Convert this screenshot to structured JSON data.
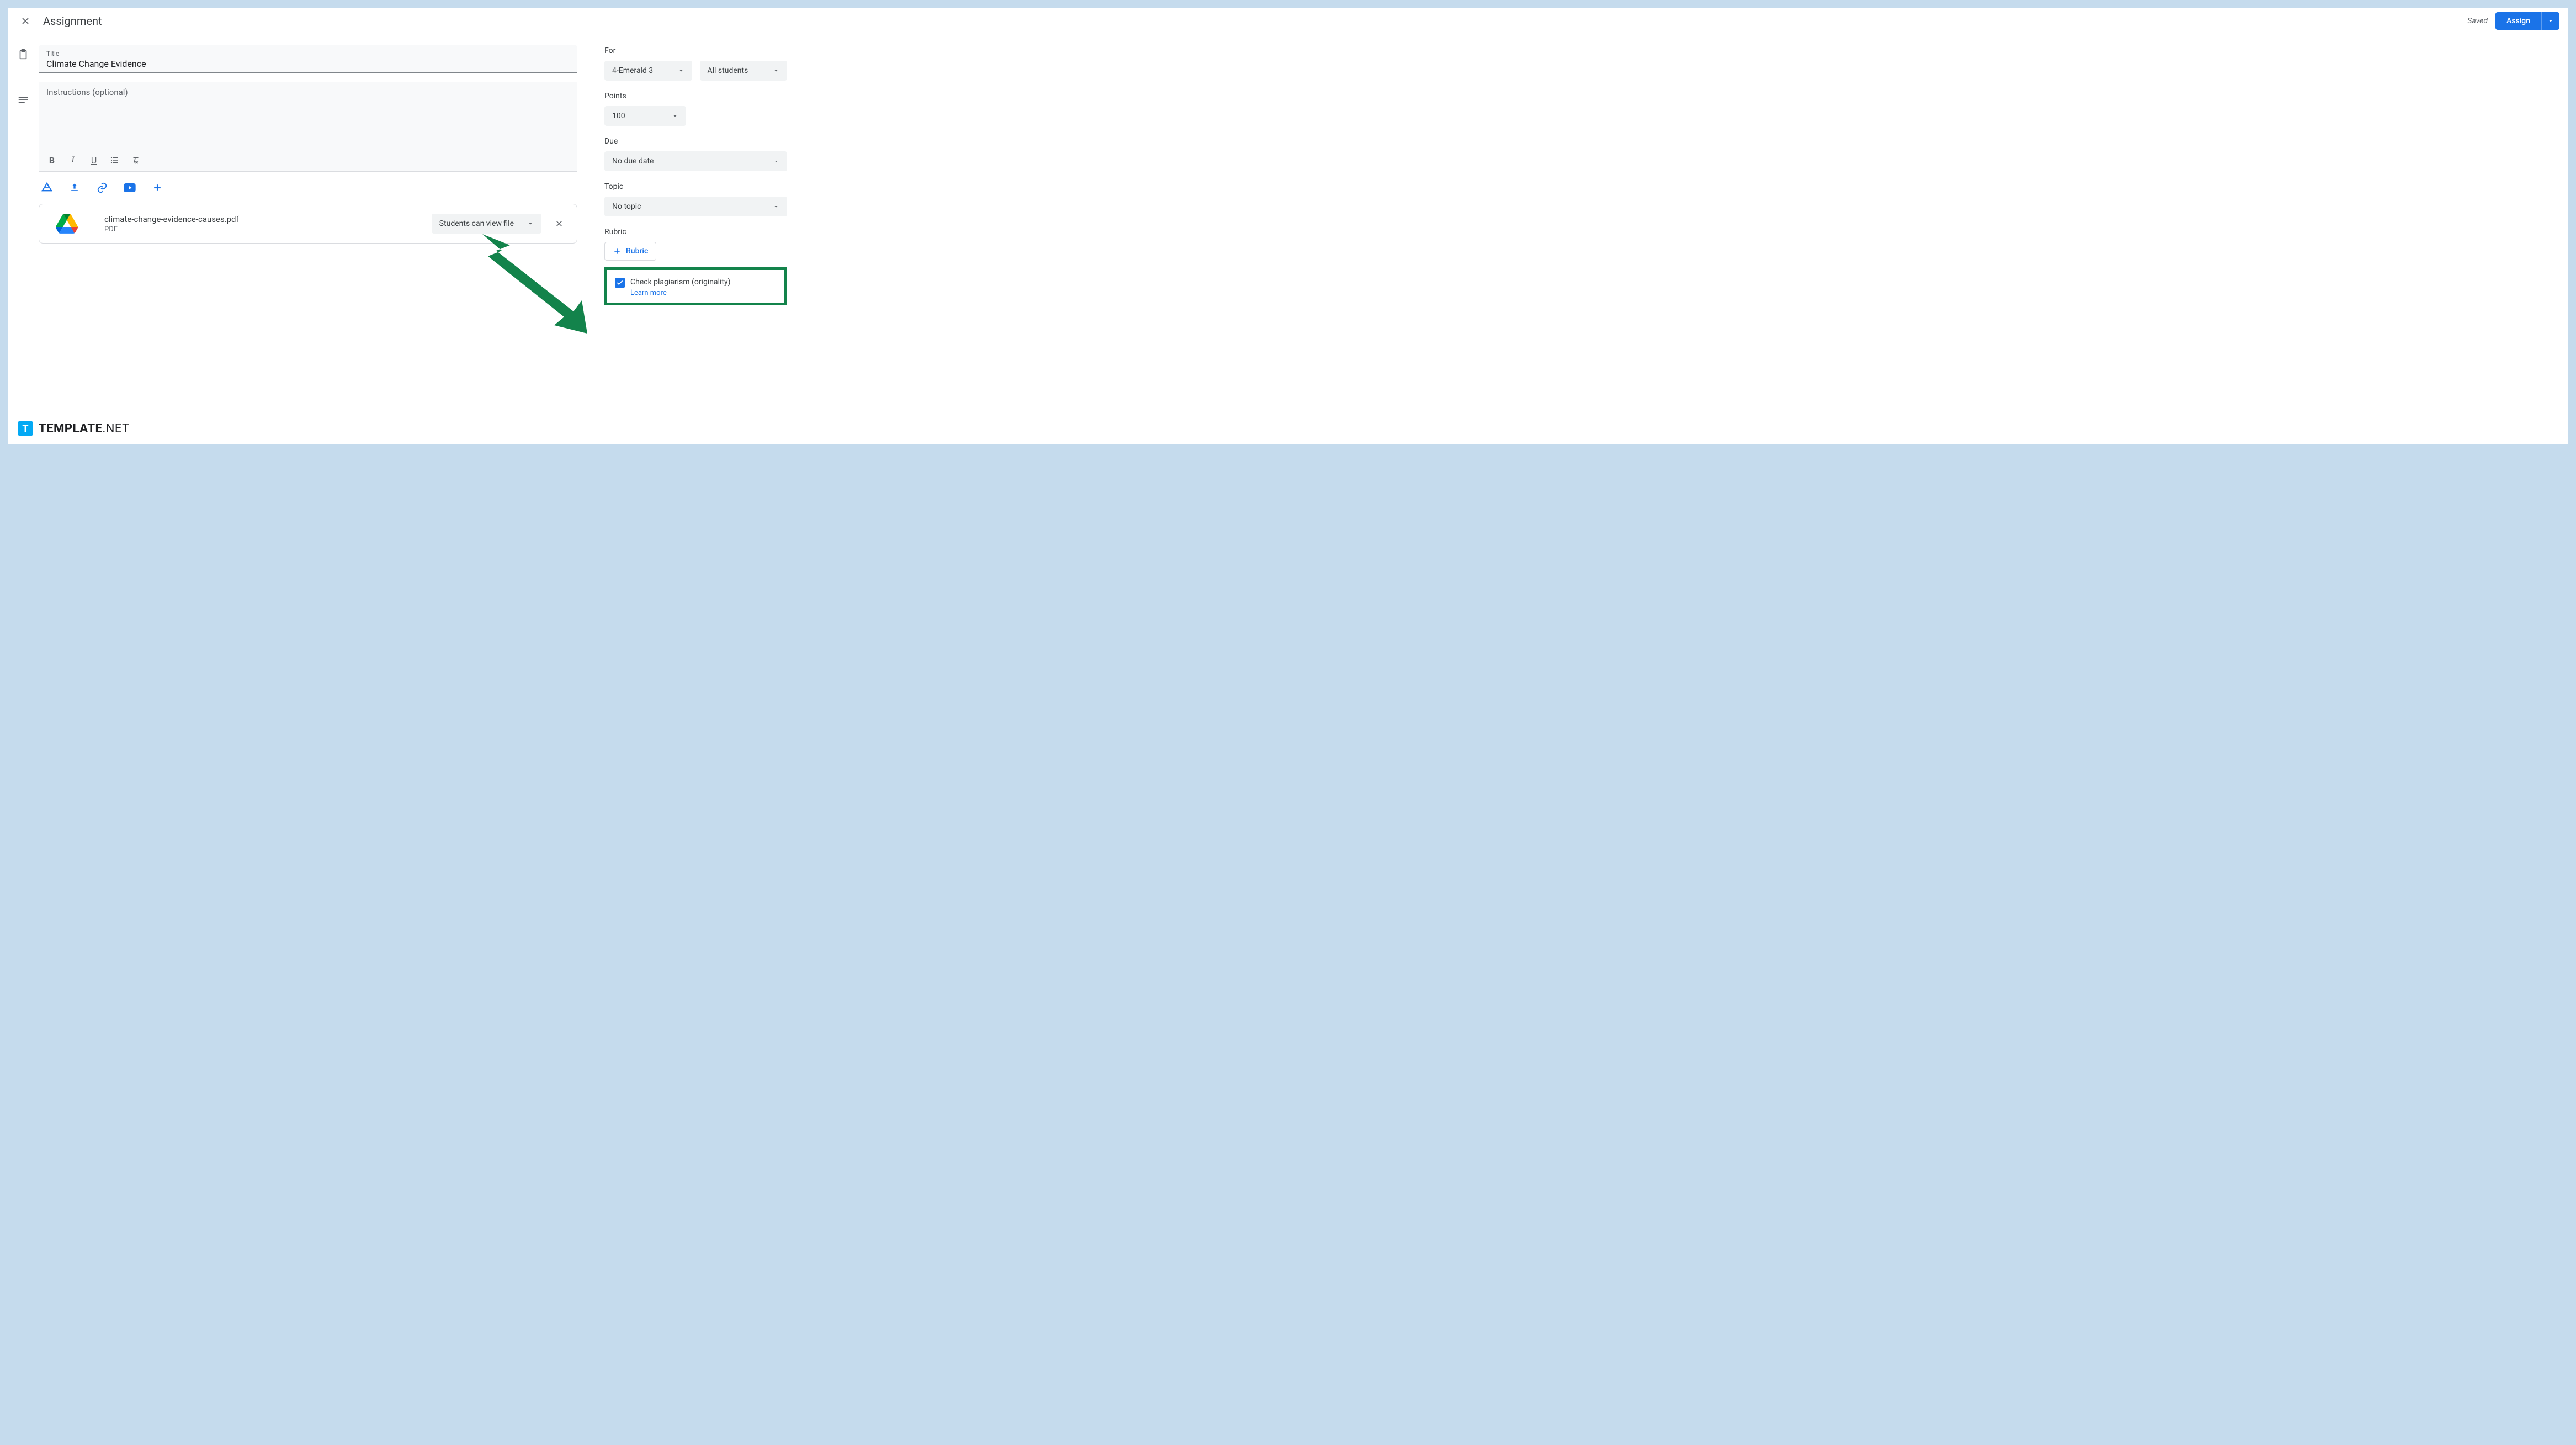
{
  "header": {
    "title": "Assignment",
    "saved": "Saved",
    "assign": "Assign"
  },
  "main": {
    "title_label": "Title",
    "title_value": "Climate Change Evidence",
    "instructions_placeholder": "Instructions (optional)",
    "attachment": {
      "name": "climate-change-evidence-causes.pdf",
      "type": "PDF",
      "permission": "Students can view file"
    }
  },
  "sidebar": {
    "for_label": "For",
    "class_value": "4-Emerald 3",
    "students_value": "All students",
    "points_label": "Points",
    "points_value": "100",
    "due_label": "Due",
    "due_value": "No due date",
    "topic_label": "Topic",
    "topic_value": "No topic",
    "rubric_label": "Rubric",
    "rubric_button": "Rubric",
    "plagiarism_label": "Check plagiarism (originality)",
    "plagiarism_checked": true,
    "learn_more": "Learn more"
  },
  "watermark": {
    "brand_bold": "TEMPLATE",
    "brand_light": ".NET"
  },
  "icons": {
    "close": "close-icon",
    "clipboard": "clipboard-icon",
    "text": "text-icon",
    "bold": "bold-icon",
    "italic": "italic-icon",
    "underline": "underline-icon",
    "list": "bullet-list-icon",
    "clear": "clear-format-icon",
    "drive": "drive-icon",
    "upload": "upload-icon",
    "link": "link-icon",
    "youtube": "youtube-icon",
    "plus": "plus-icon",
    "caret": "chevron-down-icon",
    "check": "check-icon",
    "remove": "close-icon"
  }
}
